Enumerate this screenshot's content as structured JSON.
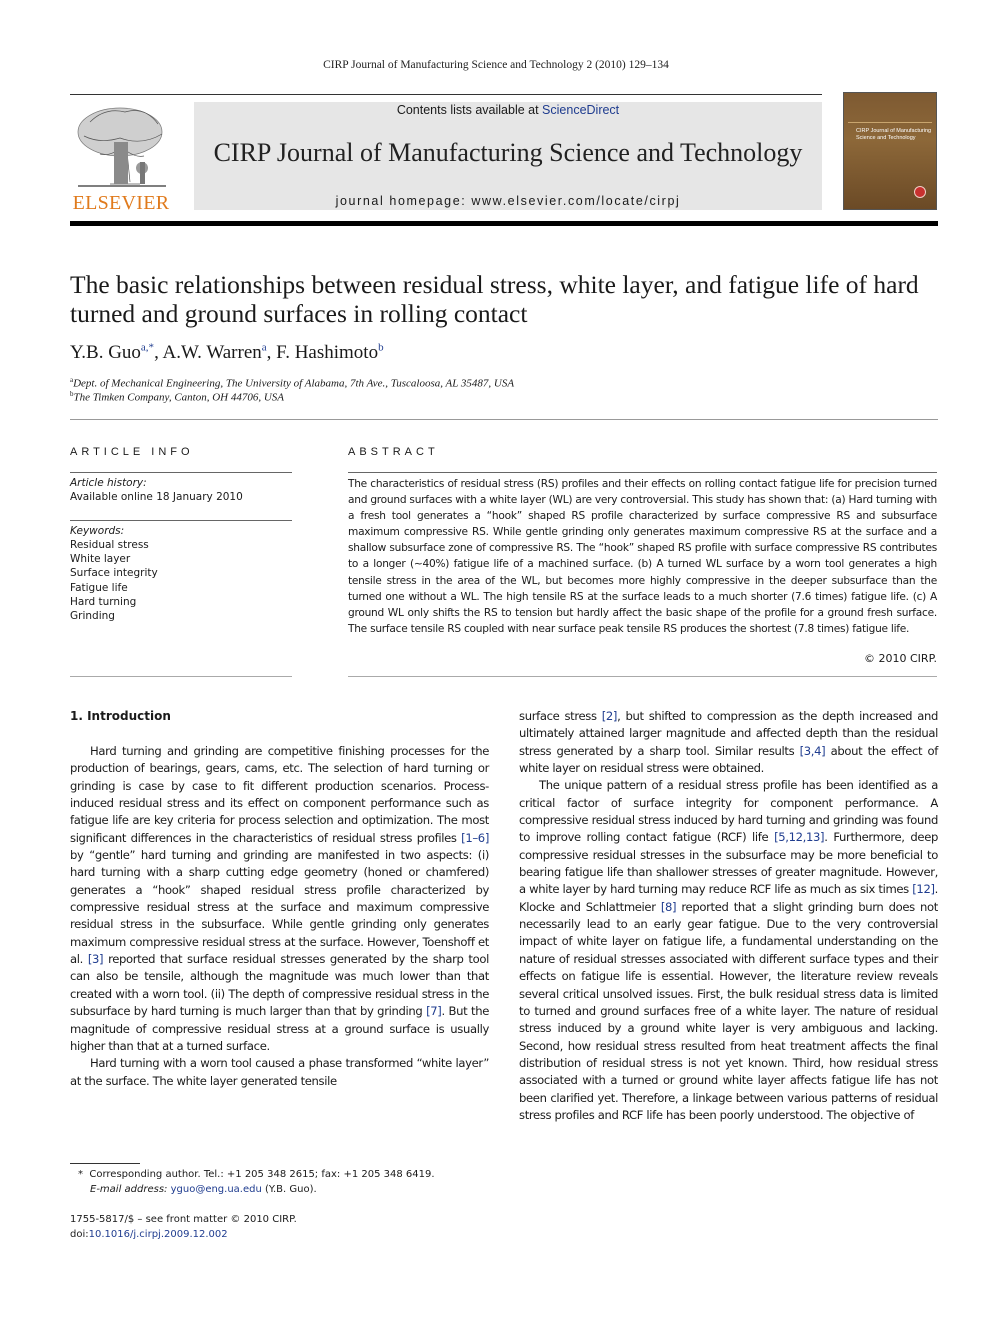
{
  "running_head": "CIRP Journal of Manufacturing Science and Technology 2 (2010) 129–134",
  "banner": {
    "contents_prefix": "Contents lists available at ",
    "contents_link": "ScienceDirect",
    "journal_title": "CIRP Journal of Manufacturing Science and Technology",
    "homepage_prefix": "journal homepage: ",
    "homepage_url": "www.elsevier.com/locate/cirpj",
    "publisher_logo": "ELSEVIER",
    "cover_text": "CIRP Journal of Manufacturing Science and Technology"
  },
  "colors": {
    "link": "#1f3c8f",
    "elsevier_orange": "#e07a1c",
    "banner_bg": "#e6e6e6",
    "cover_brown": "#7e5a32"
  },
  "article": {
    "title": "The basic relationships between residual stress, white layer, and fatigue life of hard turned and ground surfaces in rolling contact",
    "authors": [
      {
        "name": "Y.B. Guo",
        "sup": "a,*"
      },
      {
        "name": "A.W. Warren",
        "sup": "a"
      },
      {
        "name": "F. Hashimoto",
        "sup": "b"
      }
    ],
    "affiliations": [
      {
        "mark": "a",
        "text": "Dept. of Mechanical Engineering, The University of Alabama, 7th Ave., Tuscaloosa, AL 35487, USA"
      },
      {
        "mark": "b",
        "text": "The Timken Company, Canton, OH 44706, USA"
      }
    ]
  },
  "article_info": {
    "heading": "ARTICLE INFO",
    "history_label": "Article history:",
    "history_value": "Available online 18 January 2010",
    "keywords_label": "Keywords:",
    "keywords": [
      "Residual stress",
      "White layer",
      "Surface integrity",
      "Fatigue life",
      "Hard turning",
      "Grinding"
    ]
  },
  "abstract": {
    "heading": "ABSTRACT",
    "text": "The characteristics of residual stress (RS) profiles and their effects on rolling contact fatigue life for precision turned and ground surfaces with a white layer (WL) are very controversial. This study has shown that: (a) Hard turning with a fresh tool generates a “hook” shaped RS profile characterized by surface compressive RS and subsurface maximum compressive RS. While gentle grinding only generates maximum compressive RS at the surface and a shallow subsurface zone of compressive RS. The “hook” shaped RS profile with surface compressive RS contributes to a longer (∼40%) fatigue life of a machined surface. (b) A turned WL surface by a worn tool generates a high tensile stress in the area of the WL, but becomes more highly compressive in the deeper subsurface than the turned one without a WL. The high tensile RS at the surface leads to a much shorter (7.6 times) fatigue life. (c) A ground WL only shifts the RS to tension but hardly affect the basic shape of the profile for a ground fresh surface. The surface tensile RS coupled with near surface peak tensile RS produces the shortest (7.8 times) fatigue life.",
    "copyright": "© 2010 CIRP."
  },
  "section1": {
    "heading": "1.  Introduction",
    "left_col": {
      "p1": [
        {
          "t": "Hard turning and grinding are competitive finishing processes for the production of bearings, gears, cams, etc. The selection of hard turning or grinding is case by case to fit different production scenarios. Process-induced residual stress and its effect on component performance such as fatigue life are key criteria for process selection and optimization. The most significant differences in the characteristics of residual stress profiles "
        },
        {
          "c": "[1–6]"
        },
        {
          "t": " by “gentle” hard turning and grinding are manifested in two aspects: (i) hard turning with a sharp cutting edge geometry (honed or chamfered) generates a “hook” shaped residual stress profile characterized by compressive residual stress at the surface and maximum compressive residual stress in the subsurface. While gentle grinding only generates maximum compressive residual stress at the surface. However, Toenshoff et al. "
        },
        {
          "c": "[3]"
        },
        {
          "t": " reported that surface residual stresses generated by the sharp tool can also be tensile, although the magnitude was much lower than that created with a worn tool. (ii) The depth of compressive residual stress in the subsurface by hard turning is much larger than that by grinding "
        },
        {
          "c": "[7]"
        },
        {
          "t": ". But the magnitude of compressive residual stress at a ground surface is usually higher than that at a turned surface."
        }
      ],
      "p2": "Hard turning with a worn tool caused a phase transformed “white layer” at the surface. The white layer generated tensile"
    },
    "right_col": {
      "p1": [
        {
          "t": "surface stress "
        },
        {
          "c": "[2]"
        },
        {
          "t": ", but shifted to compression as the depth increased and ultimately attained larger magnitude and affected depth than the residual stress generated by a sharp tool. Similar results "
        },
        {
          "c": "[3,4]"
        },
        {
          "t": " about the effect of white layer on residual stress were obtained."
        }
      ],
      "p2": [
        {
          "t": "The unique pattern of a residual stress profile has been identified as a critical factor of surface integrity for component performance. A compressive residual stress induced by hard turning and grinding was found to improve rolling contact fatigue (RCF) life "
        },
        {
          "c": "[5,12,13]"
        },
        {
          "t": ". Furthermore, deep compressive residual stresses in the subsurface may be more beneficial to bearing fatigue life than shallower stresses of greater magnitude. However, a white layer by hard turning may reduce RCF life as much as six times "
        },
        {
          "c": "[12]"
        },
        {
          "t": ". Klocke and Schlattmeier "
        },
        {
          "c": "[8]"
        },
        {
          "t": " reported that a slight grinding burn does not necessarily lead to an early gear fatigue. Due to the very controversial impact of white layer on fatigue life, a fundamental understanding on the nature of residual stresses associated with different surface types and their effects on fatigue life is essential. However, the literature review reveals several critical unsolved issues. First, the bulk residual stress data is limited to turned and ground surfaces free of a white layer. The nature of residual stress induced by a ground white layer is very ambiguous and lacking. Second, how residual stress resulted from heat treatment affects the final distribution of residual stress is not yet known. Third, how residual stress associated with a turned or ground white layer affects fatigue life has not been clarified yet. Therefore, a linkage between various patterns of residual stress profiles and RCF life has been poorly understood. The objective of"
        }
      ]
    }
  },
  "footnote": {
    "mark": "*",
    "line1": "Corresponding author. Tel.: +1 205 348 2615; fax: +1 205 348 6419.",
    "email_label": "E-mail address: ",
    "email": "yguo@eng.ua.edu",
    "email_suffix": " (Y.B. Guo)."
  },
  "front_matter": {
    "issn": "1755-5817/$ – see front matter © 2010 CIRP.",
    "doi_prefix": "doi:",
    "doi": "10.1016/j.cirpj.2009.12.002"
  }
}
